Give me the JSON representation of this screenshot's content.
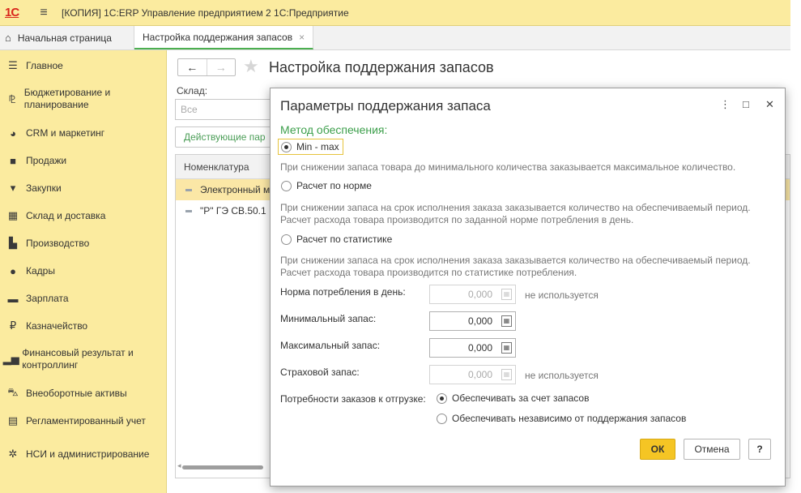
{
  "titlebar": {
    "logo": "1С",
    "menu_icon": "hamburger-icon",
    "title": "[КОПИЯ] 1С:ERP Управление предприятием 2 1С:Предприятие"
  },
  "tabs": {
    "home": "Начальная страница",
    "active": "Настройка поддержания запасов",
    "close": "×"
  },
  "sidebar": {
    "items": [
      {
        "label": "Главное",
        "icon": "list-icon"
      },
      {
        "label": "Бюджетирование и планирование",
        "icon": "budget-icon"
      },
      {
        "label": "CRM и маркетинг",
        "icon": "pie-chart-icon"
      },
      {
        "label": "Продажи",
        "icon": "bag-icon"
      },
      {
        "label": "Закупки",
        "icon": "cart-icon"
      },
      {
        "label": "Склад и доставка",
        "icon": "warehouse-icon"
      },
      {
        "label": "Производство",
        "icon": "factory-icon"
      },
      {
        "label": "Кадры",
        "icon": "person-icon"
      },
      {
        "label": "Зарплата",
        "icon": "wallet-icon"
      },
      {
        "label": "Казначейство",
        "icon": "ruble-icon"
      },
      {
        "label": "Финансовый результат и контроллинг",
        "icon": "bar-chart-icon"
      },
      {
        "label": "Внеоборотные активы",
        "icon": "car-icon"
      },
      {
        "label": "Регламентированный учет",
        "icon": "document-icon"
      },
      {
        "label": "НСИ и администрирование",
        "icon": "gear-icon"
      }
    ]
  },
  "main": {
    "title": "Настройка поддержания запасов",
    "back": "←",
    "forward": "→",
    "star": "★",
    "sklad_label": "Склад:",
    "sklad_value": "Все",
    "actions_button": "Действующие пар",
    "table_header": "Номенклатура",
    "rows": [
      "Электронный м",
      "\"Р\" ГЭ СВ.50.1"
    ]
  },
  "modal": {
    "title": "Параметры поддержания запаса",
    "more": "⋮",
    "maximize": "□",
    "close": "✕",
    "method_label": "Метод обеспечения:",
    "options": [
      {
        "label": "Min - max",
        "selected": true,
        "desc": "При снижении запаса товара до минимального количества заказывается максимальное количество."
      },
      {
        "label": "Расчет по норме",
        "selected": false,
        "desc": "При снижении запаса на срок исполнения заказа заказывается количество на обеспечиваемый период. Расчет расхода товара производится по заданной норме потребления в день."
      },
      {
        "label": "Расчет по статистике",
        "selected": false,
        "desc": "При снижении запаса на срок исполнения заказа заказывается количество на обеспечиваемый период. Расчет расхода товара производится по статистике потребления."
      }
    ],
    "fields": {
      "norm": {
        "label": "Норма потребления в день:",
        "value": "0,000",
        "note": "не используется"
      },
      "min": {
        "label": "Минимальный запас:",
        "value": "0,000"
      },
      "max": {
        "label": "Максимальный запас:",
        "value": "0,000"
      },
      "safety": {
        "label": "Страховой запас:",
        "value": "0,000",
        "note": "не используется"
      }
    },
    "needs_label": "Потребности заказов к отгрузке:",
    "needs_options": [
      {
        "label": "Обеспечивать за счет запасов",
        "selected": true
      },
      {
        "label": "Обеспечивать независимо от поддержания запасов",
        "selected": false
      }
    ],
    "ok": "ОК",
    "cancel": "Отмена",
    "help": "?"
  }
}
